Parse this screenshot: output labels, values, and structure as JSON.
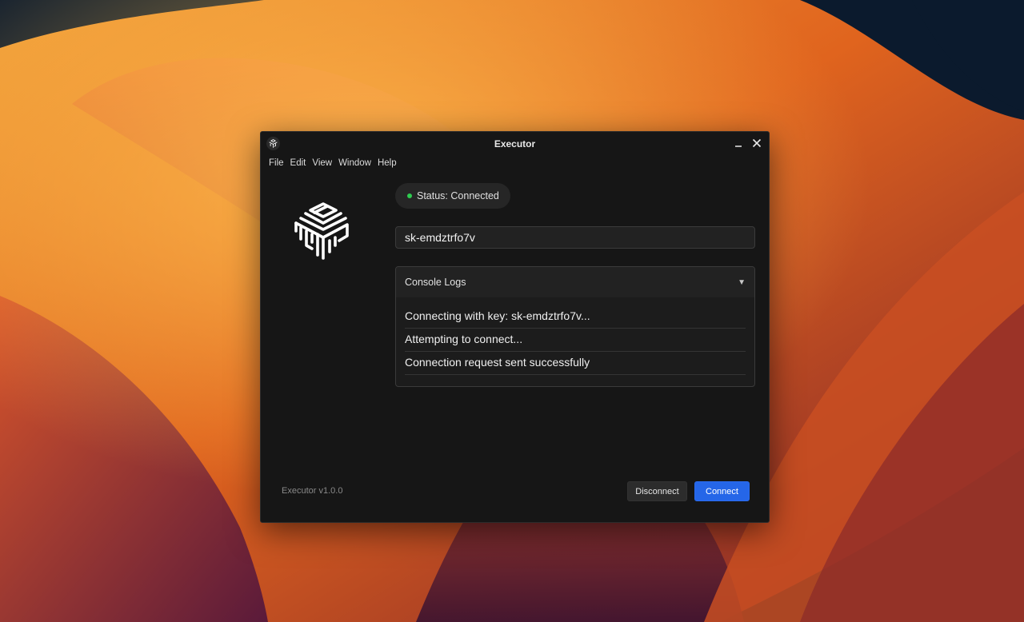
{
  "window": {
    "title": "Executor"
  },
  "menu": [
    "File",
    "Edit",
    "View",
    "Window",
    "Help"
  ],
  "status": {
    "text": "Status: Connected",
    "color": "#2ecc4f"
  },
  "key_input": {
    "value": "sk-emdztrfo7v"
  },
  "console": {
    "header": "Console Logs",
    "chevron": "▼",
    "logs": [
      "Connecting with key: sk-emdztrfo7v...",
      "Attempting to connect...",
      "Connection request sent successfully"
    ]
  },
  "footer": {
    "version": "Executor v1.0.0",
    "disconnect_label": "Disconnect",
    "connect_label": "Connect"
  },
  "colors": {
    "accent": "#2566e8",
    "window_bg": "#161616"
  }
}
